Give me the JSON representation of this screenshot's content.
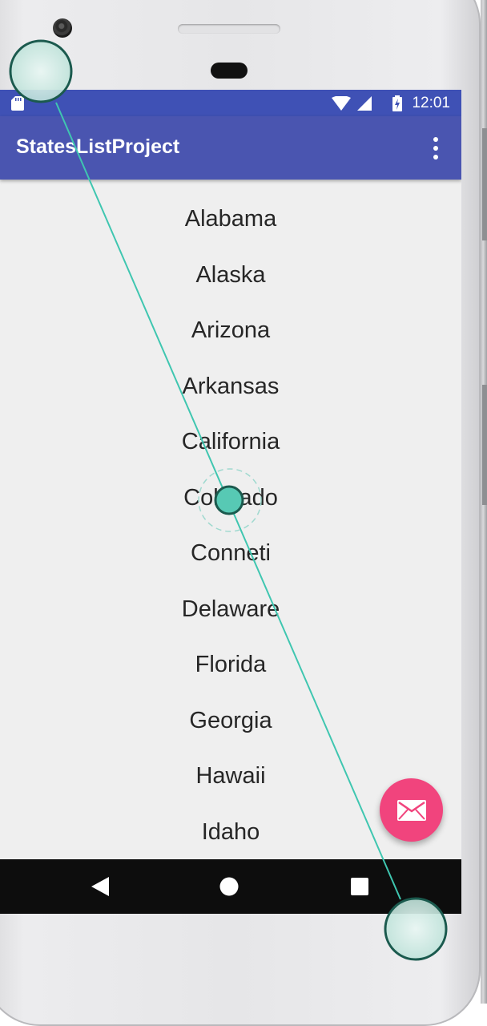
{
  "status_bar": {
    "time": "12:01"
  },
  "app_bar": {
    "title": "StatesListProject",
    "menu_icon": "more-vert-icon"
  },
  "states": [
    "Alabama",
    "Alaska",
    "Arizona",
    "Arkansas",
    "California",
    "Colorado",
    "Conneti",
    "Delaware",
    "Florida",
    "Georgia",
    "Hawaii",
    "Idaho"
  ],
  "fab": {
    "icon": "email-icon",
    "color": "#f1447d"
  },
  "colors": {
    "primary": "#3f51b5",
    "primary_dark": "#3f51b5",
    "accent": "#f1447d",
    "gesture": "#3fc6b0"
  },
  "nav_bar": {
    "back_icon": "back-triangle-icon",
    "home_icon": "home-circle-icon",
    "recents_icon": "recents-square-icon"
  },
  "gesture": {
    "type": "swipe"
  }
}
